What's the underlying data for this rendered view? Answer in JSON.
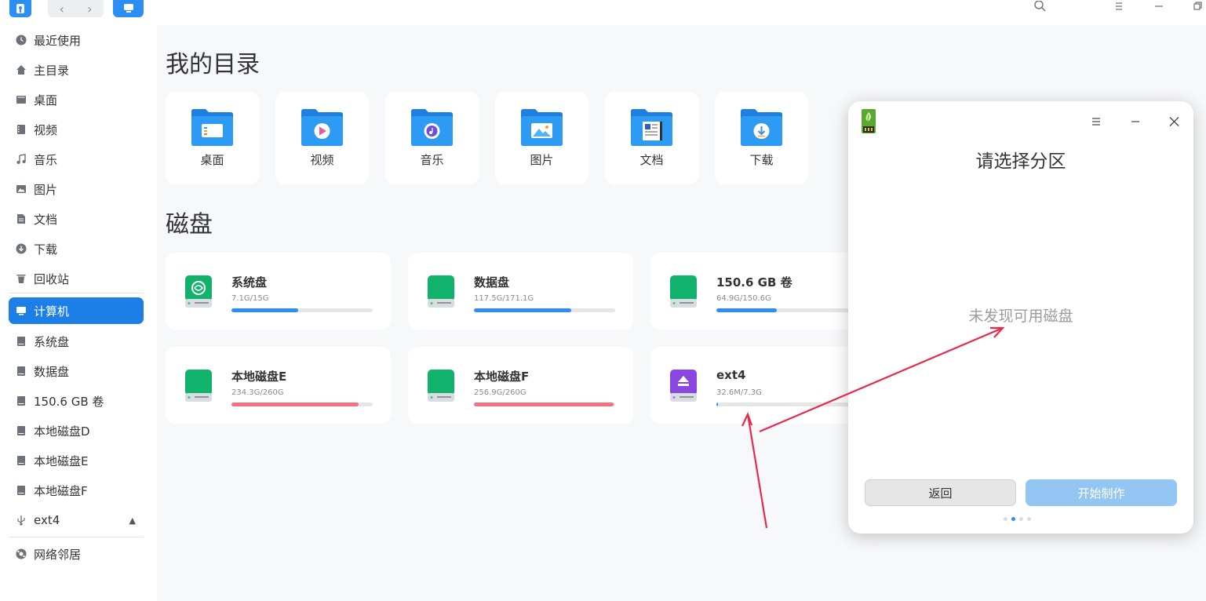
{
  "colors": {
    "accent": "#1c7fe8",
    "blue_bar": "#2b8ef5",
    "red_bar": "#f2737e",
    "disabled_button": "#94c6f4",
    "annotation_arrow": "#e8294b"
  },
  "sidebar": {
    "items": [
      {
        "label": "最近使用",
        "icon": "clock-icon"
      },
      {
        "label": "主目录",
        "icon": "home-icon"
      },
      {
        "label": "桌面",
        "icon": "desktop-icon"
      },
      {
        "label": "视频",
        "icon": "video-icon"
      },
      {
        "label": "音乐",
        "icon": "music-icon"
      },
      {
        "label": "图片",
        "icon": "picture-icon"
      },
      {
        "label": "文档",
        "icon": "document-icon"
      },
      {
        "label": "下载",
        "icon": "download-icon"
      },
      {
        "label": "回收站",
        "icon": "trash-icon"
      },
      {
        "label": "计算机",
        "icon": "computer-icon"
      },
      {
        "label": "系统盘",
        "icon": "drive-icon"
      },
      {
        "label": "数据盘",
        "icon": "drive-icon"
      },
      {
        "label": "150.6 GB 卷",
        "icon": "drive-icon"
      },
      {
        "label": "本地磁盘D",
        "icon": "drive-icon"
      },
      {
        "label": "本地磁盘E",
        "icon": "drive-icon"
      },
      {
        "label": "本地磁盘F",
        "icon": "drive-icon"
      },
      {
        "label": "ext4",
        "icon": "usb-icon"
      },
      {
        "label": "网络邻居",
        "icon": "network-icon"
      }
    ]
  },
  "main": {
    "my_dirs_title": "我的目录",
    "disks_title": "磁盘",
    "folders": [
      {
        "label": "桌面",
        "icon": "desktop-folder-icon"
      },
      {
        "label": "视频",
        "icon": "video-folder-icon"
      },
      {
        "label": "音乐",
        "icon": "music-folder-icon"
      },
      {
        "label": "图片",
        "icon": "picture-folder-icon"
      },
      {
        "label": "文档",
        "icon": "document-folder-icon"
      },
      {
        "label": "下载",
        "icon": "download-folder-icon"
      }
    ],
    "disks": [
      {
        "name": "系统盘",
        "usage": "7.1G/15G",
        "fraction": 0.47,
        "bar": "blue",
        "icon": "system-disk-icon"
      },
      {
        "name": "数据盘",
        "usage": "117.5G/171.1G",
        "fraction": 0.69,
        "bar": "blue",
        "icon": "disk-icon"
      },
      {
        "name": "150.6 GB 卷",
        "usage": "64.9G/150.6G",
        "fraction": 0.43,
        "bar": "blue",
        "icon": "disk-icon"
      },
      {
        "name": "本地磁盘E",
        "usage": "234.3G/260G",
        "fraction": 0.9,
        "bar": "red",
        "icon": "disk-icon"
      },
      {
        "name": "本地磁盘F",
        "usage": "256.9G/260G",
        "fraction": 0.99,
        "bar": "red",
        "icon": "disk-icon"
      },
      {
        "name": "ext4",
        "usage": "32.6M/7.3G",
        "fraction": 0.01,
        "bar": "blue",
        "icon": "removable-disk-icon"
      }
    ]
  },
  "dialog": {
    "title": "请选择分区",
    "empty_message": "未发现可用磁盘",
    "back_label": "返回",
    "start_label": "开始制作",
    "step_count": 4,
    "current_step": 2
  }
}
